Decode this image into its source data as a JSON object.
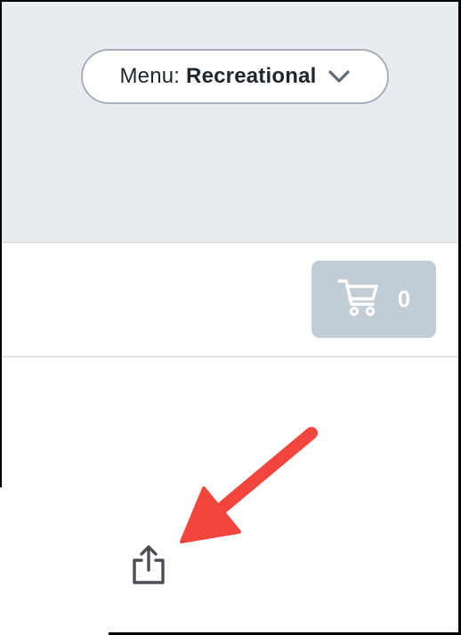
{
  "menu_selector": {
    "label": "Menu:",
    "value": "Recreational",
    "icon": "chevron-down-icon"
  },
  "cart": {
    "icon": "cart-icon",
    "count": "0"
  },
  "share": {
    "icon": "share-icon"
  },
  "annotation": {
    "icon": "arrow-annotation-icon",
    "color": "#f2453d"
  },
  "colors": {
    "header_background": "#e8ecf0",
    "cart_background": "#c3cdd5",
    "pill_border": "#a7b0ba"
  }
}
